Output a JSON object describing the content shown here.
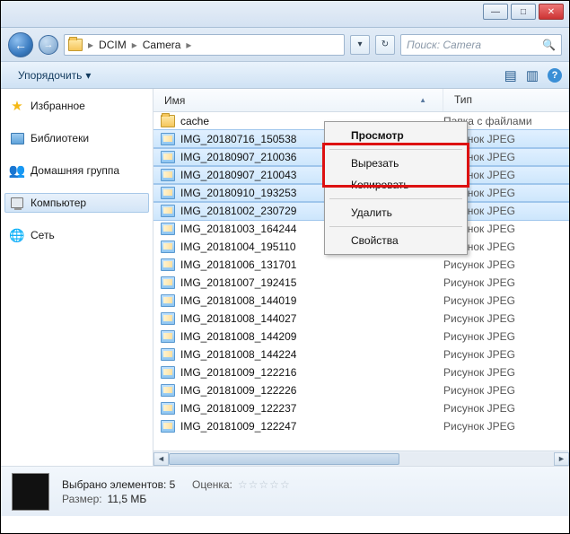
{
  "titlebar": {
    "minimize": "—",
    "maximize": "□",
    "close": "✕"
  },
  "address": {
    "back": "←",
    "forward": "→",
    "crumbs": [
      "DCIM",
      "Camera"
    ],
    "sep": "▸",
    "dropdown": "▾",
    "refresh": "↻"
  },
  "search": {
    "placeholder": "Поиск: Camera",
    "icon": "🔍"
  },
  "toolbar": {
    "organize": "Упорядочить",
    "dropdown": "▾",
    "views_icon": "▤",
    "preview_icon": "▥",
    "help_icon": "?"
  },
  "sidebar": {
    "favorites": "Избранное",
    "libraries": "Библиотеки",
    "homegroup": "Домашняя группа",
    "computer": "Компьютер",
    "network": "Сеть"
  },
  "columns": {
    "name": "Имя",
    "type": "Тип",
    "sort": "▲"
  },
  "files": [
    {
      "name": "cache",
      "type": "Папка с файлами",
      "kind": "folder",
      "selected": false
    },
    {
      "name": "IMG_20180716_150538",
      "type": "Рисунок JPEG",
      "kind": "image",
      "selected": true
    },
    {
      "name": "IMG_20180907_210036",
      "type": "Рисунок JPEG",
      "kind": "image",
      "selected": true
    },
    {
      "name": "IMG_20180907_210043",
      "type": "Рисунок JPEG",
      "kind": "image",
      "selected": true
    },
    {
      "name": "IMG_20180910_193253",
      "type": "Рисунок JPEG",
      "kind": "image",
      "selected": true
    },
    {
      "name": "IMG_20181002_230729",
      "type": "Рисунок JPEG",
      "kind": "image",
      "selected": true
    },
    {
      "name": "IMG_20181003_164244",
      "type": "Рисунок JPEG",
      "kind": "image",
      "selected": false
    },
    {
      "name": "IMG_20181004_195110",
      "type": "Рисунок JPEG",
      "kind": "image",
      "selected": false
    },
    {
      "name": "IMG_20181006_131701",
      "type": "Рисунок JPEG",
      "kind": "image",
      "selected": false
    },
    {
      "name": "IMG_20181007_192415",
      "type": "Рисунок JPEG",
      "kind": "image",
      "selected": false
    },
    {
      "name": "IMG_20181008_144019",
      "type": "Рисунок JPEG",
      "kind": "image",
      "selected": false
    },
    {
      "name": "IMG_20181008_144027",
      "type": "Рисунок JPEG",
      "kind": "image",
      "selected": false
    },
    {
      "name": "IMG_20181008_144209",
      "type": "Рисунок JPEG",
      "kind": "image",
      "selected": false
    },
    {
      "name": "IMG_20181008_144224",
      "type": "Рисунок JPEG",
      "kind": "image",
      "selected": false
    },
    {
      "name": "IMG_20181009_122216",
      "type": "Рисунок JPEG",
      "kind": "image",
      "selected": false
    },
    {
      "name": "IMG_20181009_122226",
      "type": "Рисунок JPEG",
      "kind": "image",
      "selected": false
    },
    {
      "name": "IMG_20181009_122237",
      "type": "Рисунок JPEG",
      "kind": "image",
      "selected": false
    },
    {
      "name": "IMG_20181009_122247",
      "type": "Рисунок JPEG",
      "kind": "image",
      "selected": false
    }
  ],
  "context_menu": {
    "view": "Просмотр",
    "cut": "Вырезать",
    "copy": "Копировать",
    "delete": "Удалить",
    "properties": "Свойства"
  },
  "details": {
    "selected_label": "Выбрано элементов: 5",
    "rating_label": "Оценка:",
    "stars": "☆☆☆☆☆",
    "size_label": "Размер:",
    "size_value": "11,5 МБ"
  },
  "scrollbar": {
    "left": "◄",
    "right": "►"
  }
}
